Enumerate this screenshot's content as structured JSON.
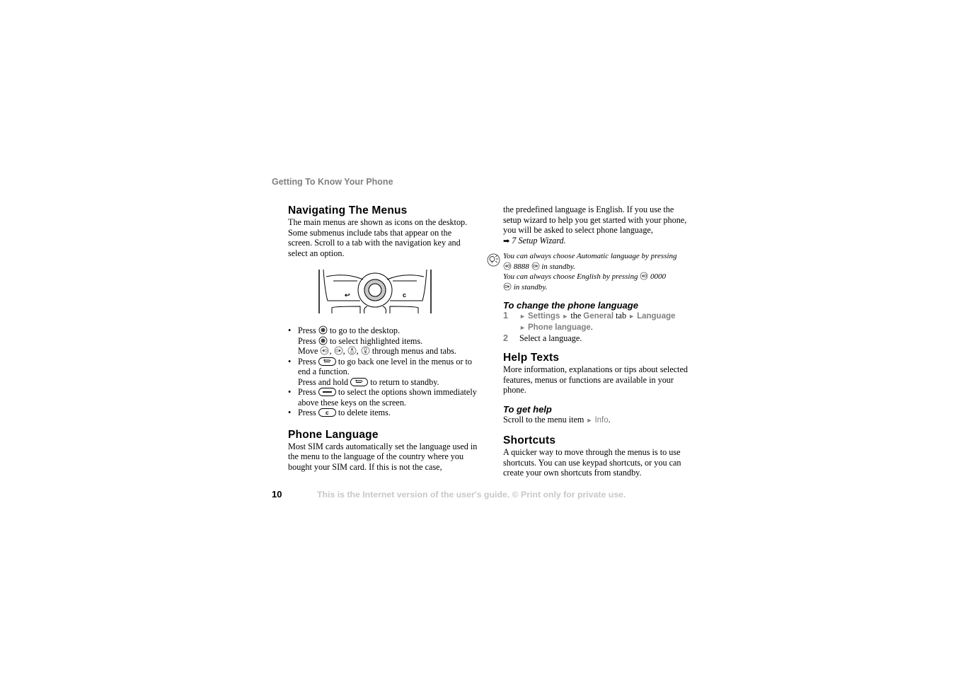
{
  "running_head": "Getting To Know Your Phone",
  "left": {
    "nav_heading": "Navigating The Menus",
    "nav_body": "The main menus are shown as icons on the desktop. Some submenus include tabs that appear on the screen. Scroll to a tab with the navigation key and select an option.",
    "figure": {
      "back_key_glyph": "↩",
      "clear_key_glyph": "c"
    },
    "bullets": [
      {
        "lines": [
          {
            "pre": "Press",
            "icon": "center-select-key-icon",
            "post": "to go to the desktop."
          },
          {
            "pre": "Press",
            "icon": "center-select-key-icon",
            "post": "to select highlighted items."
          },
          {
            "pre": "Move",
            "icon": "nav-directions-icons",
            "post": "through menus and tabs."
          }
        ]
      },
      {
        "lines": [
          {
            "pre": "Press",
            "icon": "back-key-icon",
            "post": "to go back one level in the menus or to end a function."
          },
          {
            "pre": "Press and hold",
            "icon": "back-key-icon",
            "post": "to return to standby."
          }
        ]
      },
      {
        "lines": [
          {
            "pre": "Press",
            "icon": "selection-key-icon",
            "post": "to select the options shown immediately above these keys on the screen."
          }
        ]
      },
      {
        "lines": [
          {
            "pre": "Press",
            "icon": "clear-key-icon",
            "post": "to delete items."
          }
        ]
      }
    ],
    "bullet_char": "•",
    "move_sep": ",",
    "phone_lang_heading": "Phone Language",
    "phone_lang_body": "Most SIM cards automatically set the language used in the menu to the language of the country where you bought your SIM card. If this is not the case,"
  },
  "right": {
    "cont_body": "the predefined language is English. If you use the setup wizard to help you get started with your phone, you will be asked to select phone language,",
    "xref_arrow": "➡",
    "xref_text": "7 Setup Wizard.",
    "tip": {
      "line1_pre": "You can always choose Automatic language by pressing",
      "line1_code": "8888",
      "line1_post": "in standby.",
      "line2_pre": "You can always choose English by pressing",
      "line2_code": "0000",
      "line2_post": "in standby."
    },
    "change_lang_heading": "To change the phone language",
    "steps": [
      {
        "num": "1",
        "menu1": "Settings",
        "the": "the",
        "menu2": "General",
        "tab": "tab",
        "menu3": "Language",
        "menu4": "Phone language",
        "end": "."
      },
      {
        "num": "2",
        "text": "Select a language."
      }
    ],
    "tri": "►",
    "help_heading": "Help Texts",
    "help_body": "More information, explanations or tips about selected features, menus or functions are available in your phone.",
    "get_help_heading": "To get help",
    "get_help_pre": "Scroll to the menu item",
    "get_help_menu": "Info",
    "get_help_end": ".",
    "shortcuts_heading": "Shortcuts",
    "shortcuts_body": "A quicker way to move through the menus is to use shortcuts. You can use keypad shortcuts, or you can create your own shortcuts from standby."
  },
  "footer": {
    "page_number": "10",
    "notice": "This is the Internet version of the user's guide. © Print only for private use."
  }
}
